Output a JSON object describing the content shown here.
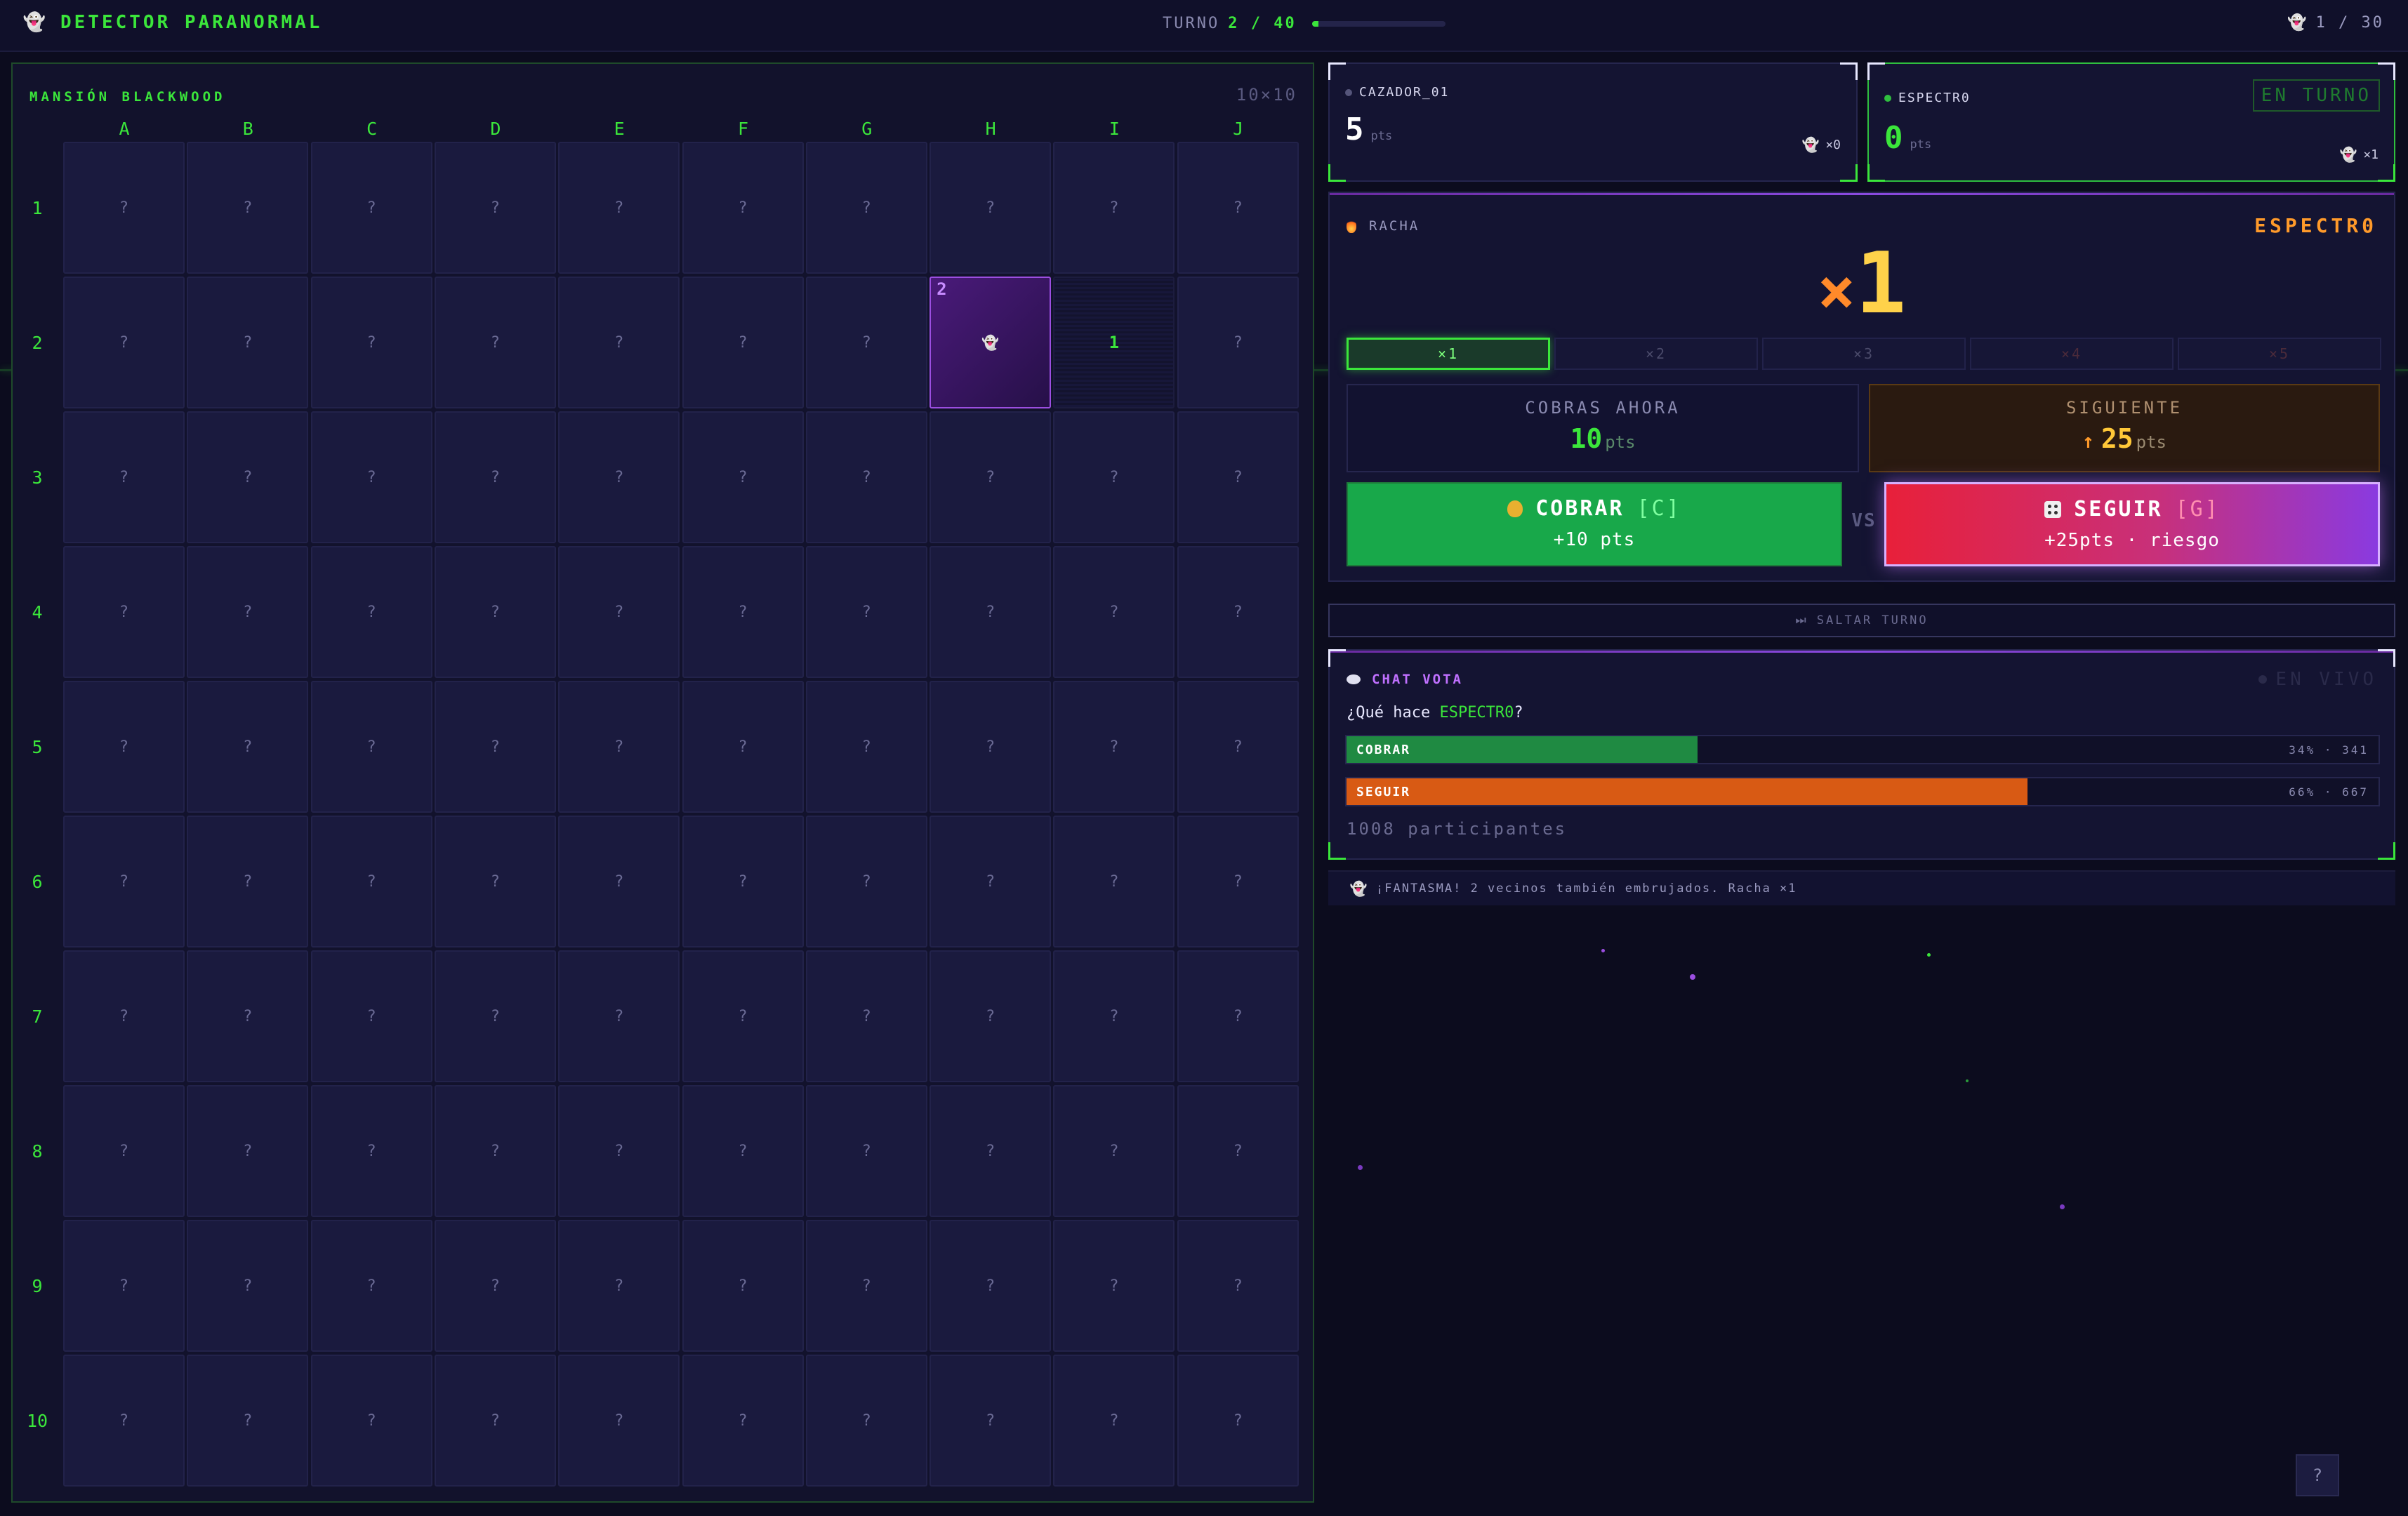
{
  "header": {
    "title": "DETECTOR PARANORMAL",
    "turn_label": "TURNO",
    "turn_value": "2 / 40",
    "turn_progress": 0.05,
    "ghosts_found": "1 / 30"
  },
  "board": {
    "title": "MANSIÓN BLACKWOOD",
    "size": "10×10",
    "columns": [
      "A",
      "B",
      "C",
      "D",
      "E",
      "F",
      "G",
      "H",
      "I",
      "J"
    ],
    "rows": [
      "1",
      "2",
      "3",
      "4",
      "5",
      "6",
      "7",
      "8",
      "9",
      "10"
    ],
    "hidden_symbol": "?",
    "revealed": [
      {
        "cell": "H2",
        "type": "ghost",
        "neighbors": "2"
      },
      {
        "cell": "I2",
        "type": "number",
        "value": "1"
      }
    ]
  },
  "players": [
    {
      "name": "CAZADOR_01",
      "score": "5",
      "unit": "pts",
      "ghosts": "×0",
      "active": false
    },
    {
      "name": "ESPECTR0",
      "score": "0",
      "unit": "pts",
      "ghosts": "×1",
      "active": true,
      "badge": "EN TURNO"
    }
  ],
  "streak": {
    "label": "RACHA",
    "player": "ESPECTR0",
    "x": "×",
    "multiplier": "1",
    "levels": [
      "×1",
      "×2",
      "×3",
      "×4",
      "×5"
    ],
    "active_level": 0,
    "cash_label": "COBRAS AHORA",
    "cash_value": "10",
    "next_label": "SIGUIENTE",
    "next_arrow": "↑",
    "next_value": "25",
    "unit": "pts",
    "vs": "VS",
    "cobrar": {
      "label": "COBRAR",
      "key": "[C]",
      "sub": "+10 pts"
    },
    "seguir": {
      "label": "SEGUIR",
      "key": "[G]",
      "sub": "+25pts · riesgo"
    }
  },
  "skip": {
    "icon": "⏭",
    "label": "SALTAR TURNO"
  },
  "chat": {
    "title": "CHAT VOTA",
    "live": "EN VIVO",
    "question_prefix": "¿Qué hace ",
    "question_name": "ESPECTR0",
    "question_suffix": "?",
    "options": [
      {
        "label": "COBRAR",
        "stat": "34% · 341",
        "share": 0.34,
        "color": "#1f8a42"
      },
      {
        "label": "SEGUIR",
        "stat": "66% · 667",
        "share": 0.66,
        "color": "#d85a14"
      }
    ],
    "participants": "1008 participantes"
  },
  "log": {
    "text": "¡FANTASMA! 2 vecinos también embrujados. Racha ×1"
  },
  "help": {
    "label": "?"
  },
  "colors": {
    "accent": "#3be63b",
    "purple": "#9b4ee0",
    "orange": "#ff8a2a",
    "bg": "#0c0c1e"
  }
}
